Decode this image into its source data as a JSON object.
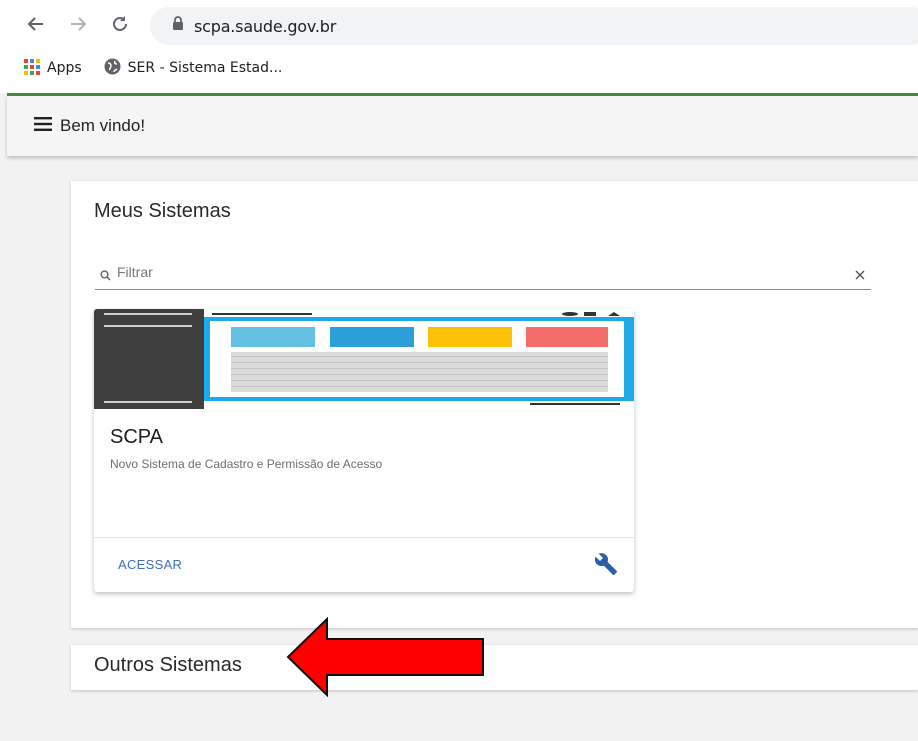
{
  "browser": {
    "url": "scpa.saude.gov.br",
    "bookmarks": [
      {
        "label": "Apps",
        "icon": "apps-grid-icon"
      },
      {
        "label": "SER - Sistema Estad...",
        "icon": "globe-icon"
      }
    ]
  },
  "appbar": {
    "title": "Bem vindo!"
  },
  "meus_sistemas": {
    "title": "Meus Sistemas",
    "filter_placeholder": "Filtrar",
    "card": {
      "name": "SCPA",
      "description": "Novo Sistema de Cadastro e Permissão de Acesso",
      "action_label": "ACESSAR"
    }
  },
  "outros_sistemas": {
    "title": "Outros Sistemas"
  },
  "colors": {
    "accent_green": "#4a8a3c",
    "link_blue": "#3f6fb5",
    "annotation_red": "#ff0000"
  }
}
